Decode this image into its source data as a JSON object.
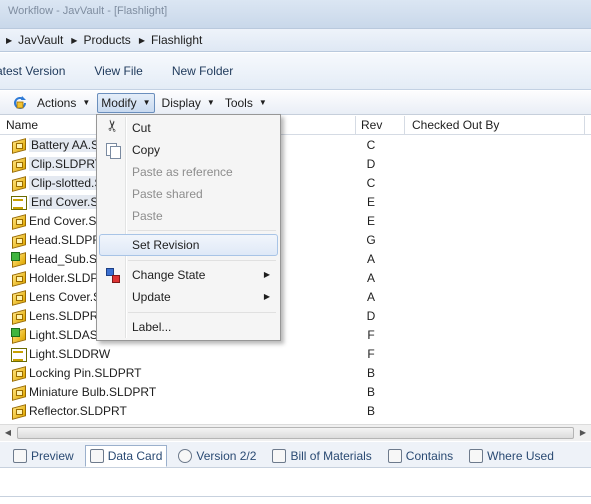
{
  "window": {
    "title": "Workflow - JavVault - [Flashlight]"
  },
  "breadcrumb": [
    "JavVault",
    "Products",
    "Flashlight"
  ],
  "commandbar": [
    "atest Version",
    "View File",
    "New Folder"
  ],
  "menubar": {
    "actions": "Actions",
    "modify": "Modify",
    "display": "Display",
    "tools": "Tools"
  },
  "columns": {
    "name": "Name",
    "rev": "Rev",
    "checked_out_by": "Checked Out By"
  },
  "files": [
    {
      "name": "Battery AA.SL",
      "rev": "C",
      "icon": "part-icon"
    },
    {
      "name": "Clip.SLDPRT",
      "rev": "D",
      "icon": "part-icon"
    },
    {
      "name": "Clip-slotted.S",
      "rev": "C",
      "icon": "part-icon"
    },
    {
      "name": "End Cover.SL",
      "rev": "E",
      "icon": "drawing-icon"
    },
    {
      "name": "End Cover.SL",
      "rev": "E",
      "icon": "part-icon"
    },
    {
      "name": "Head.SLDPRT",
      "rev": "G",
      "icon": "part-icon"
    },
    {
      "name": "Head_Sub.SL",
      "rev": "A",
      "icon": "assembly-icon"
    },
    {
      "name": "Holder.SLDP",
      "rev": "A",
      "icon": "part-icon"
    },
    {
      "name": "Lens Cover.S",
      "rev": "A",
      "icon": "part-icon"
    },
    {
      "name": "Lens.SLDPRT",
      "rev": "D",
      "icon": "part-icon"
    },
    {
      "name": "Light.SLDASI",
      "rev": "F",
      "icon": "assembly-icon"
    },
    {
      "name": "Light.SLDDRW",
      "rev": "F",
      "icon": "drawing-icon"
    },
    {
      "name": "Locking Pin.SLDPRT",
      "rev": "B",
      "icon": "part-icon"
    },
    {
      "name": "Miniature Bulb.SLDPRT",
      "rev": "B",
      "icon": "part-icon"
    },
    {
      "name": "Reflector.SLDPRT",
      "rev": "B",
      "icon": "part-icon"
    }
  ],
  "modify_menu": {
    "cut": "Cut",
    "copy": "Copy",
    "paste_as_reference": "Paste as reference",
    "paste_shared": "Paste shared",
    "paste": "Paste",
    "set_revision": "Set Revision",
    "change_state": "Change State",
    "update": "Update",
    "label": "Label..."
  },
  "tabs": {
    "preview": "Preview",
    "data_card": "Data Card",
    "version": "Version 2/2",
    "bom": "Bill of Materials",
    "contains": "Contains",
    "where_used": "Where Used"
  }
}
